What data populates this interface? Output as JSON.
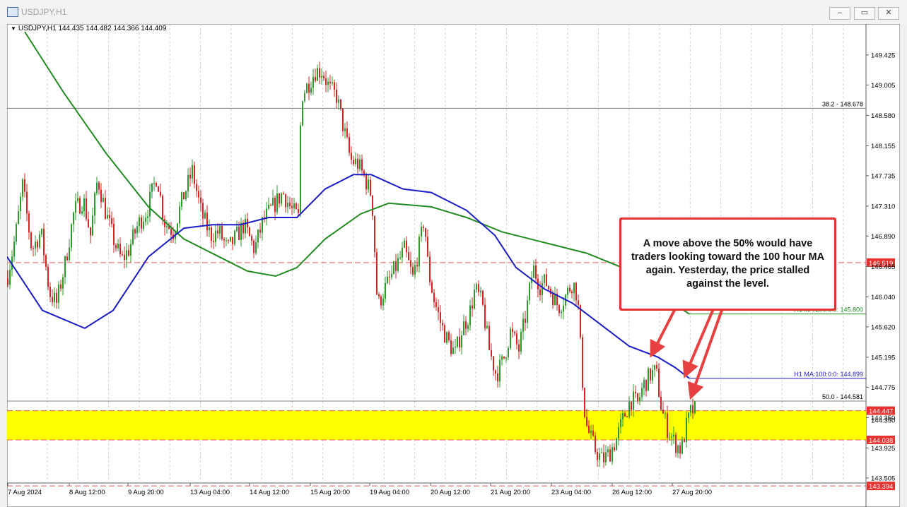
{
  "window": {
    "title": "USDJPY,H1",
    "min_glyph": "–",
    "max_glyph": "▭",
    "close_glyph": "✕",
    "icon": "chart-window-icon"
  },
  "ohlc": {
    "symbol": "USDJPY,H1",
    "open": "144.435",
    "high": "144.482",
    "low": "144.366",
    "close": "144.409"
  },
  "annotation": {
    "text": "A move above the 50% would have traders looking toward the 100 hour MA again. Yesterday, the price stalled against the level."
  },
  "colors": {
    "background": "#ffffff",
    "up": "#2e9a2e",
    "down": "#d42424",
    "ma100": "#1c1cc8",
    "ma200": "#228b22",
    "zone": "#ffff00",
    "red_line": "#e85a5a",
    "arrow": "#e84040",
    "grid": "#d0d0d0"
  },
  "chart_data": {
    "type": "candlestick",
    "symbol": "USDJPY",
    "timeframe": "H1",
    "ylim": [
      143.39,
      149.7
    ],
    "y_ticks": [
      "149.425",
      "149.005",
      "148.580",
      "148.155",
      "147.735",
      "147.310",
      "146.890",
      "146.465",
      "146.040",
      "145.620",
      "145.195",
      "144.775",
      "144.350",
      "143.925",
      "143.505"
    ],
    "x_ticks": [
      "7 Aug 2024",
      "8 Aug 12:00",
      "9 Aug 20:00",
      "13 Aug 04:00",
      "14 Aug 12:00",
      "15 Aug 20:00",
      "19 Aug 04:00",
      "20 Aug 12:00",
      "21 Aug 20:00",
      "23 Aug 04:00",
      "26 Aug 12:00",
      "27 Aug 20:00"
    ],
    "price_path": [
      [
        0,
        146.3
      ],
      [
        12,
        146.9
      ],
      [
        22,
        147.6
      ],
      [
        35,
        146.7
      ],
      [
        48,
        146.95
      ],
      [
        60,
        146.1
      ],
      [
        70,
        145.95
      ],
      [
        82,
        146.5
      ],
      [
        95,
        147.25
      ],
      [
        108,
        147.4
      ],
      [
        118,
        146.9
      ],
      [
        128,
        147.7
      ],
      [
        140,
        147.2
      ],
      [
        152,
        146.8
      ],
      [
        162,
        146.55
      ],
      [
        172,
        146.7
      ],
      [
        185,
        147.05
      ],
      [
        198,
        147.25
      ],
      [
        212,
        147.75
      ],
      [
        222,
        147.1
      ],
      [
        235,
        146.95
      ],
      [
        248,
        147.4
      ],
      [
        262,
        147.8
      ],
      [
        275,
        147.2
      ],
      [
        288,
        146.9
      ],
      [
        300,
        146.95
      ],
      [
        312,
        146.7
      ],
      [
        322,
        146.85
      ],
      [
        335,
        147.05
      ],
      [
        350,
        146.7
      ],
      [
        362,
        147.1
      ],
      [
        376,
        147.3
      ],
      [
        390,
        147.5
      ],
      [
        403,
        147.25
      ],
      [
        412,
        147.15
      ],
      [
        416,
        148.85
      ],
      [
        425,
        149.0
      ],
      [
        436,
        149.2
      ],
      [
        446,
        149.2
      ],
      [
        456,
        148.95
      ],
      [
        466,
        148.85
      ],
      [
        476,
        148.4
      ],
      [
        486,
        147.95
      ],
      [
        496,
        147.9
      ],
      [
        506,
        147.7
      ],
      [
        516,
        147.45
      ],
      [
        519,
        146.9
      ],
      [
        524,
        145.9
      ],
      [
        532,
        146.1
      ],
      [
        542,
        146.3
      ],
      [
        552,
        146.5
      ],
      [
        562,
        146.7
      ],
      [
        574,
        146.3
      ],
      [
        586,
        146.9
      ],
      [
        590,
        147.15
      ],
      [
        596,
        146.4
      ],
      [
        604,
        146.0
      ],
      [
        614,
        145.65
      ],
      [
        624,
        145.4
      ],
      [
        634,
        145.25
      ],
      [
        644,
        145.6
      ],
      [
        654,
        145.8
      ],
      [
        662,
        146.15
      ],
      [
        672,
        145.95
      ],
      [
        682,
        145.3
      ],
      [
        692,
        144.95
      ],
      [
        702,
        145.15
      ],
      [
        712,
        145.55
      ],
      [
        724,
        145.3
      ],
      [
        734,
        145.8
      ],
      [
        744,
        146.45
      ],
      [
        754,
        146.2
      ],
      [
        762,
        146.25
      ],
      [
        770,
        146.1
      ],
      [
        780,
        145.9
      ],
      [
        790,
        146.05
      ],
      [
        800,
        146.25
      ],
      [
        807,
        146.05
      ],
      [
        813,
        145.0
      ],
      [
        818,
        144.3
      ],
      [
        824,
        144.1
      ],
      [
        832,
        143.9
      ],
      [
        842,
        143.75
      ],
      [
        852,
        143.85
      ],
      [
        862,
        144.05
      ],
      [
        872,
        144.35
      ],
      [
        882,
        144.6
      ],
      [
        892,
        144.55
      ],
      [
        900,
        144.8
      ],
      [
        910,
        144.95
      ],
      [
        918,
        145.0
      ],
      [
        926,
        144.45
      ],
      [
        934,
        144.2
      ],
      [
        944,
        144.0
      ],
      [
        954,
        143.9
      ],
      [
        960,
        144.2
      ],
      [
        968,
        144.45
      ],
      [
        973,
        144.45
      ]
    ],
    "ma100": [
      [
        0,
        146.6
      ],
      [
        50,
        145.85
      ],
      [
        110,
        145.6
      ],
      [
        150,
        145.85
      ],
      [
        200,
        146.6
      ],
      [
        250,
        147.0
      ],
      [
        290,
        147.05
      ],
      [
        330,
        147.05
      ],
      [
        370,
        147.15
      ],
      [
        410,
        147.15
      ],
      [
        450,
        147.55
      ],
      [
        490,
        147.75
      ],
      [
        515,
        147.75
      ],
      [
        560,
        147.55
      ],
      [
        600,
        147.5
      ],
      [
        650,
        147.25
      ],
      [
        690,
        146.9
      ],
      [
        720,
        146.45
      ],
      [
        760,
        146.15
      ],
      [
        800,
        145.95
      ],
      [
        840,
        145.65
      ],
      [
        880,
        145.35
      ],
      [
        920,
        145.2
      ],
      [
        945,
        145.05
      ],
      [
        965,
        144.9
      ]
    ],
    "ma200": [
      [
        25,
        149.75
      ],
      [
        80,
        148.9
      ],
      [
        140,
        148.05
      ],
      [
        200,
        147.3
      ],
      [
        250,
        146.85
      ],
      [
        300,
        146.6
      ],
      [
        340,
        146.4
      ],
      [
        380,
        146.33
      ],
      [
        410,
        146.45
      ],
      [
        450,
        146.85
      ],
      [
        500,
        147.2
      ],
      [
        540,
        147.35
      ],
      [
        600,
        147.3
      ],
      [
        650,
        147.15
      ],
      [
        700,
        146.95
      ],
      [
        760,
        146.8
      ],
      [
        820,
        146.65
      ],
      [
        870,
        146.45
      ],
      [
        920,
        146.1
      ],
      [
        965,
        145.8
      ]
    ],
    "horizontal_lines": [
      {
        "label": "38.2 - 148.678",
        "value": 148.678,
        "style": "solid",
        "color": "#808080"
      },
      {
        "label": "50.0 - 144.581",
        "value": 144.581,
        "style": "solid",
        "color": "#808080"
      },
      {
        "label": "H1 MA:200:0:0: 145.800",
        "value": 145.8,
        "style": "solid",
        "color": "#228b22",
        "start_x": 965
      },
      {
        "label": "H1 MA:100:0:0: 144.899",
        "value": 144.899,
        "style": "solid",
        "color": "#1c1cc8",
        "start_x": 965
      }
    ],
    "price_tags": [
      {
        "label": "146.519",
        "value": 146.519,
        "style": "dashed",
        "color": "#e85a5a"
      },
      {
        "label": "144.447",
        "value": 144.447,
        "style": "dashed",
        "color": "#e85a5a"
      },
      {
        "label": "144.038",
        "value": 144.038,
        "style": "dashed",
        "color": "#e85a5a"
      },
      {
        "label": "143.394",
        "value": 143.394,
        "style": "dashed",
        "color": "#e85a5a"
      }
    ],
    "highlight_zone": {
      "from": 144.038,
      "to": 144.447,
      "color": "#ffff00"
    },
    "arrows": [
      {
        "from": [
          957,
          380
        ],
        "to": [
          915,
          462
        ]
      },
      {
        "from": [
          1009,
          380
        ],
        "to": [
          962,
          491
        ]
      },
      {
        "from": [
          1020,
          380
        ],
        "to": [
          970,
          521
        ]
      }
    ],
    "current_price_stub": "144.350"
  }
}
